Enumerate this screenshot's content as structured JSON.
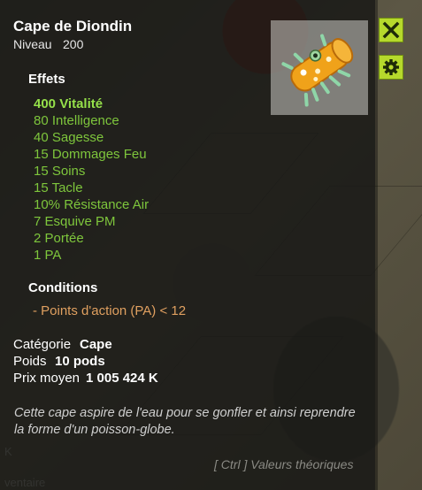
{
  "item": {
    "name": "Cape de Diondin",
    "level_label": "Niveau",
    "level_value": "200",
    "image_icon": "cape-icon"
  },
  "effects": {
    "heading": "Effets",
    "items": [
      "400 Vitalité",
      "80 Intelligence",
      "40 Sagesse",
      "15 Dommages Feu",
      "15 Soins",
      "15 Tacle",
      "10% Résistance Air",
      "7 Esquive PM",
      "2 Portée",
      "1 PA"
    ]
  },
  "conditions": {
    "heading": "Conditions",
    "items": [
      "- Points d'action (PA) < 12"
    ]
  },
  "meta": {
    "category_label": "Catégorie",
    "category_value": "Cape",
    "weight_label": "Poids",
    "weight_value": "10 pods",
    "price_label": "Prix moyen",
    "price_value": "1 005 424 K"
  },
  "description": "Cette cape aspire de l'eau pour se gonfler et ainsi reprendre la forme d'un poisson-globe.",
  "hint": "[ Ctrl ] Valeurs théoriques",
  "buttons": {
    "close_icon": "close-icon",
    "settings_icon": "gear-icon"
  },
  "background_fragments": {
    "left_letter": "K",
    "bottom_text": "ventaire"
  },
  "colors": {
    "effect_green": "#7ec63c",
    "condition_orange": "#e0a060",
    "button_green": "#b6d92c"
  }
}
